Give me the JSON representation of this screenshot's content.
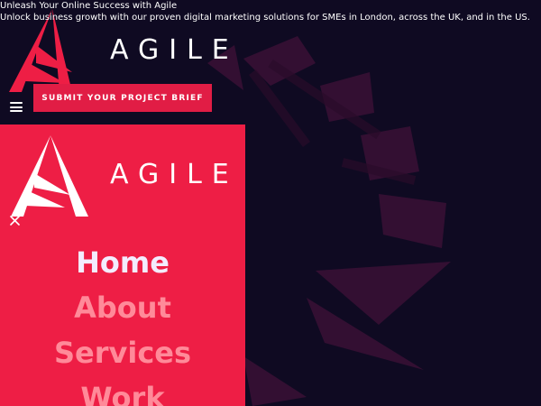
{
  "hero": {
    "tagline_title": "Unleash Your Online Success with Agile",
    "tagline_subtitle": "Unlock business growth with our proven digital marketing solutions for SMEs in London, across the UK, and in the US."
  },
  "header": {
    "brand": "AGILE",
    "cta_label": "SUBMIT YOUR PROJECT BRIEF"
  },
  "menu": {
    "brand": "AGILE",
    "items": [
      {
        "label": "Home",
        "active": true
      },
      {
        "label": "About",
        "active": false
      },
      {
        "label": "Services",
        "active": false
      },
      {
        "label": "Work",
        "active": false
      }
    ]
  },
  "colors": {
    "background": "#0f0a22",
    "accent": "#ee1e45",
    "menu_link": "#ff8a99",
    "menu_link_active": "#f3ecff"
  },
  "icons": {
    "menu": "hamburger-icon",
    "close": "close-icon",
    "logo": "agile-logo"
  }
}
